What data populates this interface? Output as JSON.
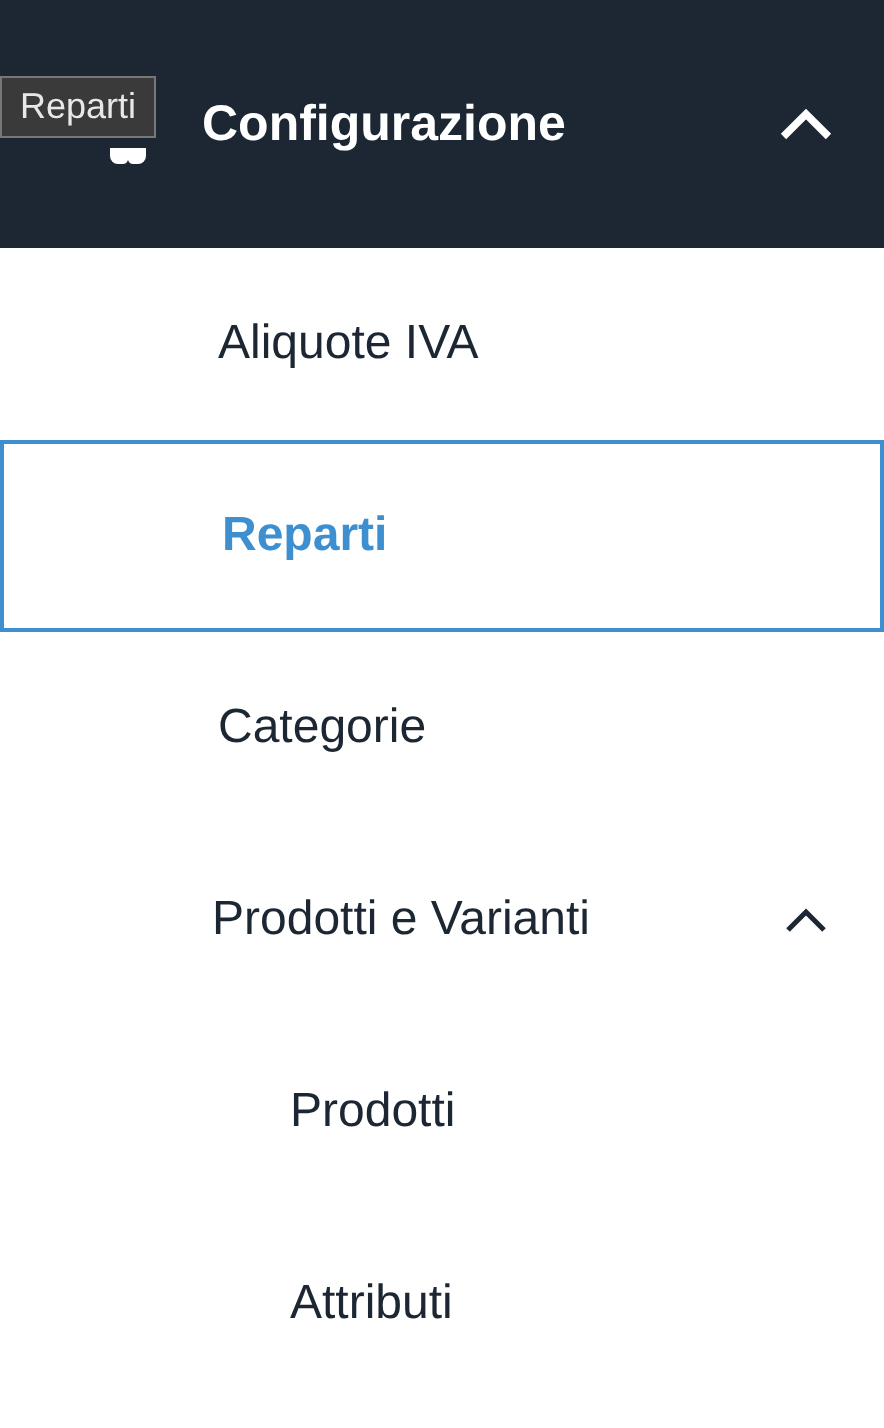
{
  "tooltip": "Reparti",
  "section": {
    "title": "Configurazione",
    "expanded": true
  },
  "items": [
    {
      "label": "Aliquote IVA",
      "selected": false
    },
    {
      "label": "Reparti",
      "selected": true
    },
    {
      "label": "Categorie",
      "selected": false
    },
    {
      "label": "Prodotti e Varianti",
      "selected": false,
      "expanded": true,
      "children": [
        {
          "label": "Prodotti",
          "selected": false
        },
        {
          "label": "Attributi",
          "selected": false
        }
      ]
    }
  ]
}
